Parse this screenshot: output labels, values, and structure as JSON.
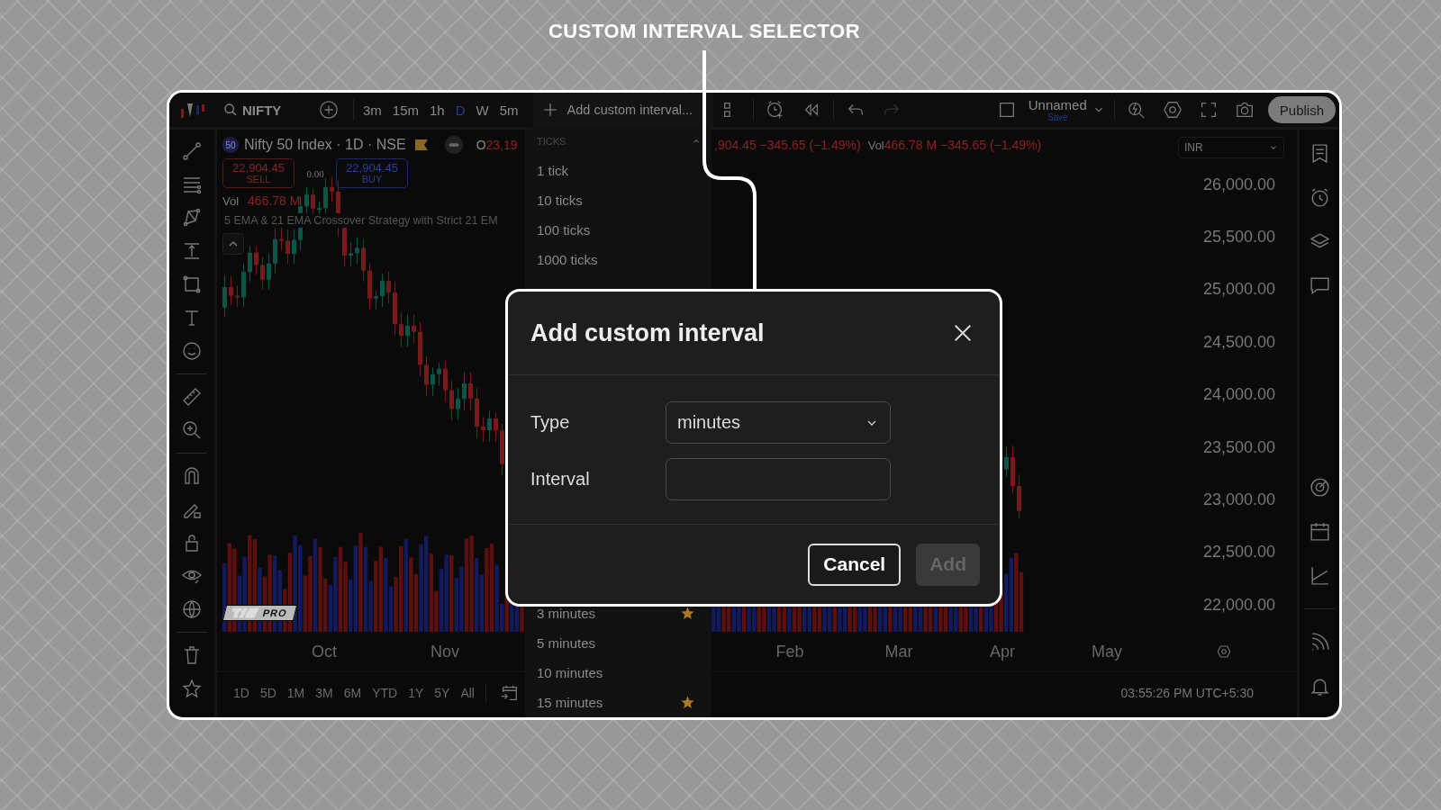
{
  "annotation": {
    "title": "CUSTOM INTERVAL SELECTOR"
  },
  "top_toolbar": {
    "symbol": "NIFTY",
    "intervals": [
      {
        "label": "3m",
        "selected": false
      },
      {
        "label": "15m",
        "selected": false
      },
      {
        "label": "1h",
        "selected": false
      },
      {
        "label": "D",
        "selected": true
      },
      {
        "label": "W",
        "selected": false
      },
      {
        "label": "5m",
        "selected": false
      }
    ],
    "add_custom_interval": "Add custom interval...",
    "layout_name": "Unnamed",
    "save_label": "Save",
    "publish": "Publish"
  },
  "legend": {
    "symbol_badge": "50",
    "title": "Nifty 50 Index · 1D · NSE",
    "open_label": "O",
    "open_value": "23,19",
    "values_right": ",904.45 −345.65 (−1.49%)",
    "vol_label_right": "Vol",
    "vol_values_right": "466.78 M −345.65 (−1.49%)",
    "sell": {
      "price": "22,904.45",
      "label": "SELL"
    },
    "spread": "0.00",
    "buy": {
      "price": "22,904.45",
      "label": "BUY"
    },
    "volume": {
      "label": "Vol",
      "value": "466.78 M"
    },
    "indicator": "5 EMA & 21 EMA Crossover Strategy with Strict 21 EM"
  },
  "chart_badge": "PRO",
  "price_axis": {
    "currency": "INR",
    "labels": [
      "26,000.00",
      "25,500.00",
      "25,000.00",
      "24,500.00",
      "24,000.00",
      "23,500.00",
      "23,000.00",
      "22,500.00",
      "22,000.00"
    ]
  },
  "time_axis": {
    "labels": [
      "Oct",
      "Nov",
      "Feb",
      "Mar",
      "Apr",
      "May"
    ]
  },
  "bottom_bar": {
    "ranges": [
      "1D",
      "5D",
      "1M",
      "3M",
      "6M",
      "YTD",
      "1Y",
      "5Y",
      "All"
    ],
    "clock": "03:55:26 PM UTC+5:30"
  },
  "interval_menu": {
    "section": "TICKS",
    "expanded": true,
    "items_top": [
      {
        "label": "1 tick",
        "starred": false
      },
      {
        "label": "10 ticks",
        "starred": false
      },
      {
        "label": "100 ticks",
        "starred": false
      },
      {
        "label": "1000 ticks",
        "starred": false
      }
    ],
    "items_bottom": [
      {
        "label": "3 minutes",
        "starred": true
      },
      {
        "label": "5 minutes",
        "starred": false
      },
      {
        "label": "10 minutes",
        "starred": false
      },
      {
        "label": "15 minutes",
        "starred": true
      }
    ]
  },
  "dialog": {
    "title": "Add custom interval",
    "fields": [
      {
        "label": "Type",
        "kind": "select",
        "value": "minutes"
      },
      {
        "label": "Interval",
        "kind": "input"
      }
    ],
    "buttons": [
      {
        "label": "Cancel",
        "disabled": false
      },
      {
        "label": "Add",
        "disabled": true
      }
    ]
  }
}
